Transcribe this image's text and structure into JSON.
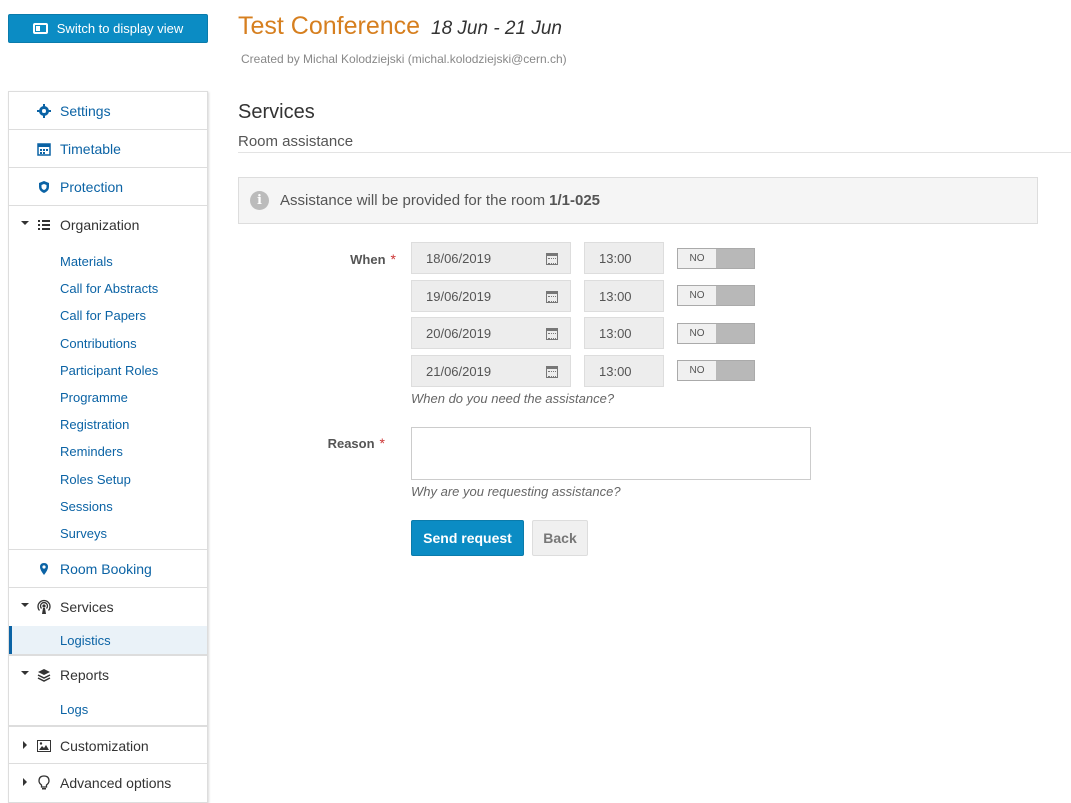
{
  "switch_button": {
    "label": "Switch to display view"
  },
  "event": {
    "title": "Test Conference",
    "dates": "18 Jun - 21 Jun",
    "created_by": "Created by Michal Kolodziejski (michal.kolodziejski@cern.ch)"
  },
  "sidebar": {
    "settings": "Settings",
    "timetable": "Timetable",
    "protection": "Protection",
    "organization": {
      "label": "Organization",
      "items": [
        "Materials",
        "Call for Abstracts",
        "Call for Papers",
        "Contributions",
        "Participant Roles",
        "Programme",
        "Registration",
        "Reminders",
        "Roles Setup",
        "Sessions",
        "Surveys"
      ]
    },
    "room_booking": "Room Booking",
    "services": {
      "label": "Services",
      "items": [
        "Logistics"
      ]
    },
    "reports": {
      "label": "Reports",
      "items": [
        "Logs"
      ]
    },
    "customization": "Customization",
    "advanced": "Advanced options"
  },
  "page": {
    "title": "Services",
    "subtitle": "Room assistance",
    "info_text": "Assistance will be provided for the room",
    "room": "1/1-025"
  },
  "form": {
    "when_label": "When",
    "required_mark": "*",
    "rows": [
      {
        "date": "18/06/2019",
        "time": "13:00",
        "toggle": "NO"
      },
      {
        "date": "19/06/2019",
        "time": "13:00",
        "toggle": "NO"
      },
      {
        "date": "20/06/2019",
        "time": "13:00",
        "toggle": "NO"
      },
      {
        "date": "21/06/2019",
        "time": "13:00",
        "toggle": "NO"
      }
    ],
    "when_help": "When do you need the assistance?",
    "reason_label": "Reason",
    "reason_value": "",
    "reason_help": "Why are you requesting assistance?",
    "send_label": "Send request",
    "back_label": "Back"
  },
  "colors": {
    "accent": "#0b8cc4",
    "link": "#0b63a5",
    "title": "#d67f1f"
  }
}
